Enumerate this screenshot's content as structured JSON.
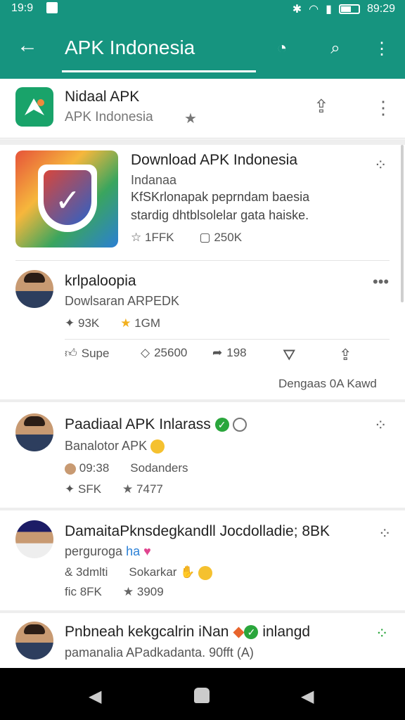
{
  "status_bar": {
    "time": "19:9",
    "right_time": "89:29"
  },
  "toolbar": {
    "title": "APK Indonesia"
  },
  "app_header": {
    "name": "Nidaal APK",
    "subtitle": "APK Indonesia"
  },
  "featured": {
    "title": "Download APK Indonesia",
    "subtitle": "Indanaa",
    "line1": "KfSKrlonapak peprndam baesia",
    "line2": "stardig dhtblsolelar gata haiske.",
    "stat1": "1FFK",
    "stat2": "250K"
  },
  "post1": {
    "name": "krlpaloopia",
    "sub": "Dowlsaran ARPEDK",
    "stat1": "93K",
    "stat2": "1GM",
    "actions": {
      "like": "Supe",
      "comment": "25600",
      "share": "198"
    },
    "footer": "Dengaas 0A Kawd"
  },
  "post2": {
    "name": "Paadiaal APK Inlarass",
    "sub": "Banalotor APK",
    "meta1": "09:38",
    "meta2": "Sodanders",
    "stat1": "SFK",
    "stat2": "7477"
  },
  "post3": {
    "name": "DamaitaPknsdegkandll Jocdolladie; 8BK",
    "sub_a": "perguroga",
    "sub_b": "ha",
    "meta1": "& 3dmlti",
    "meta2": "Sokarkar",
    "stat1": "fic 8FK",
    "stat2": "3909"
  },
  "post4": {
    "name": "Pnbneah kekgcalrin iNan",
    "name_tail": "inlangd",
    "sub": "pamanalia APadkadanta. 90fft (A)"
  },
  "colors": {
    "accent": "#16947f",
    "verified": "#2aa63c"
  }
}
